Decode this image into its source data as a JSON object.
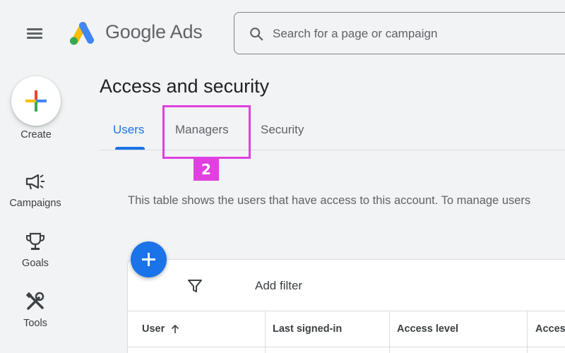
{
  "header": {
    "app_name": "Google Ads",
    "search": {
      "placeholder": "Search for a page or campaign",
      "value": ""
    }
  },
  "rail": {
    "create_label": "Create",
    "items": [
      {
        "label": "Campaigns",
        "icon": "megaphone-icon"
      },
      {
        "label": "Goals",
        "icon": "trophy-icon"
      },
      {
        "label": "Tools",
        "icon": "tools-icon"
      }
    ]
  },
  "page": {
    "title": "Access and security",
    "tabs": [
      {
        "label": "Users",
        "active": true
      },
      {
        "label": "Managers",
        "active": false
      },
      {
        "label": "Security",
        "active": false
      }
    ],
    "description": "This table shows the users that have access to this account. To manage users"
  },
  "callout": {
    "number": "2",
    "color": "#e040e0"
  },
  "table": {
    "add_filter_label": "Add filter",
    "columns": [
      "User",
      "Last signed-in",
      "Access level",
      "Access"
    ]
  },
  "colors": {
    "accent": "#1a73e8",
    "background": "#f1f3f4"
  }
}
